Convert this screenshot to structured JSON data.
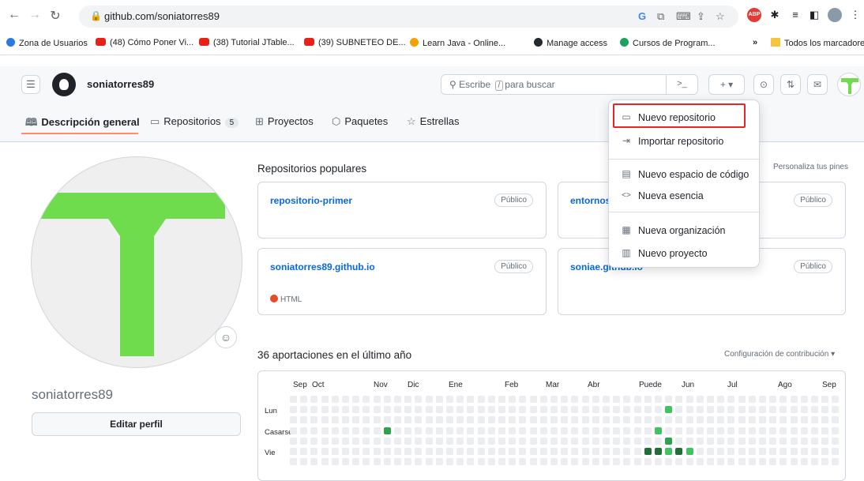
{
  "browser": {
    "url": "github.com/soniatorres89",
    "bookmarks": [
      {
        "label": "Zona de Usuarios",
        "color": "#2a7ae2"
      },
      {
        "label": "(48) Cómo Poner Vi...",
        "color": "#e62117"
      },
      {
        "label": "(38) Tutorial JTable...",
        "color": "#e62117"
      },
      {
        "label": "(39) SUBNETEO DE...",
        "color": "#e62117"
      },
      {
        "label": "Learn Java - Online...",
        "color": "#f6a000"
      },
      {
        "label": "Manage access",
        "color": "#24292f"
      },
      {
        "label": "Cursos de Program...",
        "color": "#1aa260"
      }
    ],
    "more": "»",
    "all_bookmarks": "Todos los marcadores"
  },
  "header": {
    "username": "soniatorres89",
    "search_prefix": "Escribe",
    "search_key": "/",
    "search_suffix": "para buscar",
    "terminal": ">_",
    "plus": "+ ▾"
  },
  "tabs": [
    {
      "icon": "book-icon",
      "glyph": "🕮",
      "label": "Descripción general"
    },
    {
      "icon": "repo-icon",
      "glyph": "▭",
      "label": "Repositorios",
      "count": "5"
    },
    {
      "icon": "table-icon",
      "glyph": "⊞",
      "label": "Proyectos"
    },
    {
      "icon": "package-icon",
      "glyph": "⬡",
      "label": "Paquetes"
    },
    {
      "icon": "star-icon",
      "glyph": "☆",
      "label": "Estrellas"
    }
  ],
  "profile": {
    "name": "soniatorres89",
    "edit": "Editar perfil",
    "emoji": "☺"
  },
  "popular": {
    "title": "Repositorios populares",
    "customize": "Personaliza tus pines",
    "repos": [
      {
        "name": "repositorio-primer",
        "visibility": "Público",
        "lang": ""
      },
      {
        "name": "entornos",
        "visibility": "Público",
        "lang": ""
      },
      {
        "name": "soniatorres89.github.io",
        "visibility": "Público",
        "lang": "HTML"
      },
      {
        "name": "soniae.github.io",
        "visibility": "Público",
        "lang": ""
      }
    ]
  },
  "contributions": {
    "title": "36 aportaciones en el último año",
    "settings": "Configuración de contribución ▾",
    "months": [
      "Sep",
      "Oct",
      "Nov",
      "Dic",
      "Ene",
      "Feb",
      "Mar",
      "Abr",
      "Puede",
      "Jun",
      "Jul",
      "Ago",
      "Sep"
    ],
    "days": [
      "Lun",
      "Casarse",
      "Vie"
    ]
  },
  "dropdown": {
    "items": [
      {
        "icon": "repo-icon",
        "glyph": "▭",
        "label": "Nuevo repositorio"
      },
      {
        "icon": "import-icon",
        "glyph": "⇥",
        "label": "Importar repositorio"
      },
      {
        "icon": "codespace-icon",
        "glyph": "▤",
        "label": "Nuevo espacio de código"
      },
      {
        "icon": "code-icon",
        "glyph": "<>",
        "label": "Nueva esencia"
      },
      {
        "icon": "organization-icon",
        "glyph": "▦",
        "label": "Nueva organización"
      },
      {
        "icon": "project-icon",
        "glyph": "▥",
        "label": "Nuevo proyecto"
      }
    ]
  },
  "colors": {
    "accent": "#0969da",
    "green": "#6fdc4e",
    "highlight": "#e5242b",
    "tab_underline": "#fd8c73"
  }
}
